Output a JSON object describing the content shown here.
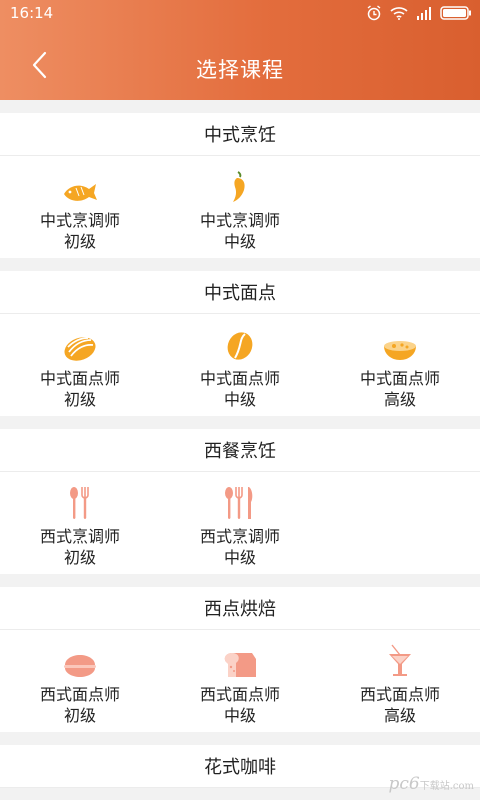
{
  "status_bar": {
    "time": "16:14",
    "icons": [
      "alarm-icon",
      "wifi-icon",
      "signal-icon",
      "battery-icon"
    ]
  },
  "header": {
    "back_icon": "chevron-left-icon",
    "title": "选择课程"
  },
  "colors": {
    "header_gradient_start": "#ee8e62",
    "header_gradient_end": "#d95f2f",
    "icon_orange": "#f5a623",
    "icon_salmon": "#f39a86"
  },
  "sections": [
    {
      "title": "中式烹饪",
      "courses": [
        {
          "name": "中式烹调师",
          "level": "初级",
          "icon": "fish-icon"
        },
        {
          "name": "中式烹调师",
          "level": "中级",
          "icon": "chili-icon"
        }
      ]
    },
    {
      "title": "中式面点",
      "courses": [
        {
          "name": "中式面点师",
          "level": "初级",
          "icon": "bread-icon"
        },
        {
          "name": "中式面点师",
          "level": "中级",
          "icon": "bean-icon"
        },
        {
          "name": "中式面点师",
          "level": "高级",
          "icon": "soup-icon"
        }
      ]
    },
    {
      "title": "西餐烹饪",
      "courses": [
        {
          "name": "西式烹调师",
          "level": "初级",
          "icon": "spoon-fork-icon"
        },
        {
          "name": "西式烹调师",
          "level": "中级",
          "icon": "cutlery-icon"
        }
      ]
    },
    {
      "title": "西点烘焙",
      "courses": [
        {
          "name": "西式面点师",
          "level": "初级",
          "icon": "macaron-icon"
        },
        {
          "name": "西式面点师",
          "level": "中级",
          "icon": "toast-icon"
        },
        {
          "name": "西式面点师",
          "level": "高级",
          "icon": "cocktail-icon"
        }
      ]
    },
    {
      "title": "花式咖啡",
      "courses": []
    }
  ],
  "watermark": {
    "main": "pc6",
    "sub": "下载站",
    "domain": ".com"
  }
}
